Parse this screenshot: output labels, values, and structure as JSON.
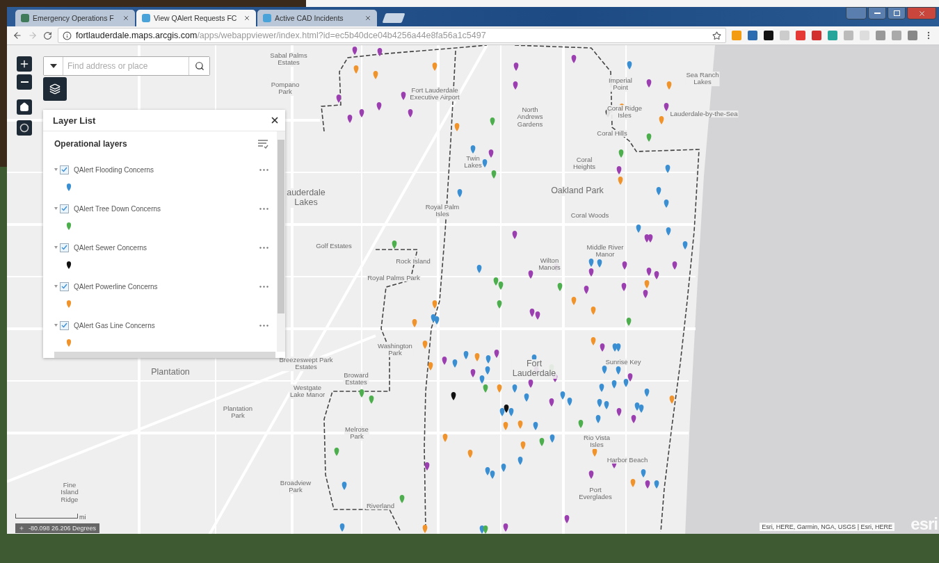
{
  "browser": {
    "tabs": [
      {
        "title": "Emergency Operations F",
        "selected": false
      },
      {
        "title": "View QAlert Requests FC",
        "selected": true
      },
      {
        "title": "Active CAD Incidents",
        "selected": false
      }
    ],
    "url": {
      "host": "fortlauderdale.maps.arcgis.com",
      "path": "/apps/webappviewer/index.html?id=ec5b40dce04b4256a44e8fa56a1c5497"
    }
  },
  "map": {
    "search": {
      "placeholder": "Find address or place"
    },
    "layer_list": {
      "title": "Layer List",
      "section": "Operational layers",
      "layers": [
        {
          "name": "QAlert Flooding Concerns",
          "checked": true,
          "color": "#3a8fd3"
        },
        {
          "name": "QAlert Tree Down Concerns",
          "checked": true,
          "color": "#4cae4c"
        },
        {
          "name": "QAlert Sewer Concerns",
          "checked": true,
          "color": "#111111"
        },
        {
          "name": "QAlert Powerline Concerns",
          "checked": true,
          "color": "#f0932b"
        },
        {
          "name": "QAlert Gas Line Concerns",
          "checked": true,
          "color": "#f0932b"
        }
      ]
    },
    "place_labels": [
      {
        "lines": [
          "Sabal Palms",
          "Estates"
        ],
        "kind": "small"
      },
      {
        "lines": [
          "Pompano",
          "Park"
        ],
        "kind": "small"
      },
      {
        "lines": [
          "Fort Lauderdale",
          "Executive Airport"
        ],
        "kind": "small"
      },
      {
        "lines": [
          "North",
          "Andrews",
          "Gardens"
        ],
        "kind": "small"
      },
      {
        "lines": [
          "Imperial",
          "Point"
        ],
        "kind": "small"
      },
      {
        "lines": [
          "Coral Ridge",
          "Isles"
        ],
        "kind": "small"
      },
      {
        "lines": [
          "Sea Ranch",
          "Lakes"
        ],
        "kind": "small"
      },
      {
        "lines": [
          "Lauderdale-by-the-Sea"
        ],
        "kind": "small"
      },
      {
        "lines": [
          "Coral Hills"
        ],
        "kind": "small"
      },
      {
        "lines": [
          "Coral",
          "Heights"
        ],
        "kind": "small"
      },
      {
        "lines": [
          "Oakland Park"
        ],
        "kind": "large"
      },
      {
        "lines": [
          "Twin",
          "Lakes"
        ],
        "kind": "small"
      },
      {
        "lines": [
          "auderdale",
          "Lakes"
        ],
        "kind": "large"
      },
      {
        "lines": [
          "Royal Palm",
          "Isles"
        ],
        "kind": "small"
      },
      {
        "lines": [
          "Coral Woods"
        ],
        "kind": "small"
      },
      {
        "lines": [
          "Golf Estates"
        ],
        "kind": "small"
      },
      {
        "lines": [
          "Middle River",
          "Manor"
        ],
        "kind": "small"
      },
      {
        "lines": [
          "Rock Island"
        ],
        "kind": "small"
      },
      {
        "lines": [
          "Wilton",
          "Manors"
        ],
        "kind": "small"
      },
      {
        "lines": [
          "Royal Palms Park"
        ],
        "kind": "small"
      },
      {
        "lines": [
          "Washington",
          "Park"
        ],
        "kind": "small"
      },
      {
        "lines": [
          "Breezeswept Park",
          "Estates"
        ],
        "kind": "small"
      },
      {
        "lines": [
          "Sunrise Key"
        ],
        "kind": "small"
      },
      {
        "lines": [
          "Plantation"
        ],
        "kind": "large"
      },
      {
        "lines": [
          "Broward",
          "Estates"
        ],
        "kind": "small"
      },
      {
        "lines": [
          "Westgate",
          "Lake Manor"
        ],
        "kind": "small"
      },
      {
        "lines": [
          "Fort",
          "Lauderdale"
        ],
        "kind": "large"
      },
      {
        "lines": [
          "Plantation",
          "Park"
        ],
        "kind": "small"
      },
      {
        "lines": [
          "Melrose",
          "Park"
        ],
        "kind": "small"
      },
      {
        "lines": [
          "Rio Vista",
          "Isles"
        ],
        "kind": "small"
      },
      {
        "lines": [
          "Harbor Beach"
        ],
        "kind": "small"
      },
      {
        "lines": [
          "Port",
          "Everglades"
        ],
        "kind": "small"
      },
      {
        "lines": [
          "Broadview",
          "Park"
        ],
        "kind": "small"
      },
      {
        "lines": [
          "Riverland"
        ],
        "kind": "small"
      },
      {
        "lines": [
          "Fine",
          "Island",
          "Ridge"
        ],
        "kind": "small"
      }
    ],
    "scale_unit": "mi",
    "coordinates": "-80.098 26.206 Degrees",
    "attribution": "Esri, HERE, Garmin, NGA, USGS | Esri, HERE",
    "logo": "esri"
  }
}
